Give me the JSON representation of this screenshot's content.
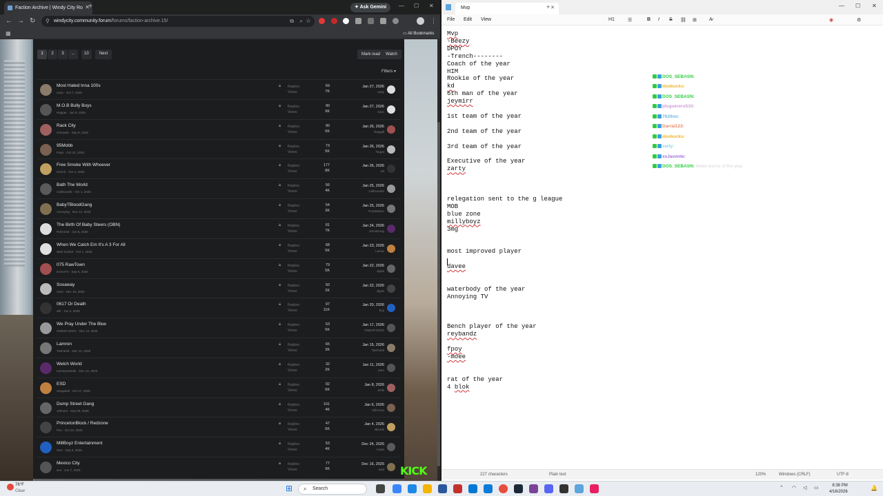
{
  "browser": {
    "tab_title": "Faction Archive | Windy City Ro",
    "ask_gemini": "Ask Gemini",
    "url_domain": "windycity.community.forum",
    "url_path": "/forums/faction-archive.15/",
    "all_bookmarks": "All Bookmarks"
  },
  "forum": {
    "pages": [
      "1",
      "2",
      "3",
      "...",
      "10",
      "Next"
    ],
    "mark_read": "Mark read",
    "watch": "Watch",
    "filters": "Filters ▾",
    "replies_label": "Replies:",
    "views_label": "Views:",
    "threads": [
      {
        "title": "Most Hated Inna 100s",
        "meta": "zarty · Oct 7, 2025",
        "replies": "69",
        "views": "7K",
        "date": "Jan 27, 2026",
        "user": "zarty"
      },
      {
        "title": "M.O.B Bully Boys",
        "meta": "Nappat · Jun 8, 2025",
        "replies": "90",
        "views": "9K",
        "date": "Jan 27, 2026",
        "user": "Dom"
      },
      {
        "title": "Rack City",
        "meta": "chrisweb · Sep 8, 2025",
        "replies": "90",
        "views": "5K",
        "date": "Jan 26, 2026",
        "user": "Rasgall"
      },
      {
        "title": "95Mobb",
        "meta": "Pops · Oct 22, 2025",
        "replies": "73",
        "views": "5K",
        "date": "Jan 26, 2026",
        "user": "Target"
      },
      {
        "title": "Free Smoke With Whoever",
        "meta": "Grinch · Oct 2, 2025",
        "replies": "177",
        "views": "8K",
        "date": "Jan 26, 2026",
        "user": "wit"
      },
      {
        "title": "Bath The World",
        "meta": "CallGooefe · Oct 1, 2025",
        "replies": "56",
        "views": "4K",
        "date": "Jan 25, 2026",
        "user": "CallGooefe"
      },
      {
        "title": "BabyTBloodGang",
        "meta": "Annoying · Nov 12, 2025",
        "replies": "54",
        "views": "3K",
        "date": "Jan 25, 2026",
        "user": "PurpMaxim"
      },
      {
        "title": "The Birth Of Baby Steers (OBN)",
        "meta": "RIZGrind · Jun 8, 2025",
        "replies": "81",
        "views": "7K",
        "date": "Jan 24, 2026",
        "user": "smooDoog"
      },
      {
        "title": "When We Catch Em It's A 3 For All",
        "meta": "Web Socket · Oct 1, 2025",
        "replies": "68",
        "views": "5K",
        "date": "Jan 23, 2026",
        "user": "Lamar"
      },
      {
        "title": "075 RawTown",
        "meta": "lcsmoTV · Sep 9, 2025",
        "replies": "79",
        "views": "5K",
        "date": "Jan 22, 2026",
        "user": "Jigsw"
      },
      {
        "title": "Sosaway",
        "meta": "Gars · Dec 19, 2025",
        "replies": "50",
        "views": "2K",
        "date": "Jan 22, 2026",
        "user": "Jigsw"
      },
      {
        "title": "0617 Or Death",
        "meta": "will · Jun 4, 2025",
        "replies": "97",
        "views": "11K",
        "date": "Jan 20, 2026",
        "user": "boy"
      },
      {
        "title": "We Pray Under The Blue",
        "meta": "ONEOF1DOG · Dec 14, 2025",
        "replies": "63",
        "views": "5K",
        "date": "Jan 17, 2026",
        "user": "ONEOF1DOG"
      },
      {
        "title": "Lamron",
        "meta": "TaxFamb · Dec 14, 2025",
        "replies": "65",
        "views": "3K",
        "date": "Jan 15, 2026",
        "user": "TaxFamb"
      },
      {
        "title": "Welch World",
        "meta": "moneymamde · Dec 14, 2025",
        "replies": "32",
        "views": "2K",
        "date": "Jan 11, 2026",
        "user": "pam"
      },
      {
        "title": "ESD",
        "meta": "sacapastl · Oct 17, 2025",
        "replies": "92",
        "views": "6K",
        "date": "Jan 8, 2026",
        "user": "Zelis"
      },
      {
        "title": "Dump Street Gang",
        "meta": "Jefmont · Sep 29, 2025",
        "replies": "101",
        "views": "4K",
        "date": "Jan 6, 2026",
        "user": "KillAmon"
      },
      {
        "title": "PrincetonBlock / Redzone",
        "meta": "Pex · Oct 23, 2025",
        "replies": "47",
        "views": "6K",
        "date": "Jan 4, 2026",
        "user": "Blends"
      },
      {
        "title": "MillBoyz Entertainment",
        "meta": "Gee · Sep 6, 2025",
        "replies": "53",
        "views": "4K",
        "date": "Dec 24, 2025",
        "user": "Kwits"
      },
      {
        "title": "Mexico City",
        "meta": "ses · Jun 7, 2025",
        "replies": "77",
        "views": "9K",
        "date": "Dec 16, 2025",
        "user": "said"
      }
    ]
  },
  "notepad": {
    "tab_title": "Mvp",
    "menu": [
      "File",
      "Edit",
      "View"
    ],
    "heading_btn": "H1",
    "lines": [
      {
        "t": "Mvp",
        "sq": true
      },
      {
        "t": "-Beezy",
        "sq": true
      },
      {
        "t": "DPOY"
      },
      {
        "t": "-Trench--------"
      },
      {
        "t": "Coach of the year"
      },
      {
        "t": "HIM"
      },
      {
        "t": "Rookie of the year"
      },
      {
        "t": "kd",
        "sq": true
      },
      {
        "t": "6th man of the year"
      },
      {
        "t": "jeymirr",
        "sq": true
      },
      {
        "t": ""
      },
      {
        "t": "1st team of the year"
      },
      {
        "t": ""
      },
      {
        "t": "2nd team of the year"
      },
      {
        "t": ""
      },
      {
        "t": "3rd team of the year"
      },
      {
        "t": ""
      },
      {
        "t": "Executive of the year"
      },
      {
        "t": "zarty",
        "sq": true
      },
      {
        "t": ""
      },
      {
        "t": ""
      },
      {
        "t": ""
      },
      {
        "t": "relegation sent to the g league"
      },
      {
        "t": "MOB"
      },
      {
        "t": "blue zone"
      },
      {
        "t": "millyboyz",
        "sq": true
      },
      {
        "t": "3mg"
      },
      {
        "t": ""
      },
      {
        "t": ""
      },
      {
        "t": "most improved player"
      },
      {
        "t": ""
      },
      {
        "t": "davee",
        "sq": true
      },
      {
        "t": ""
      },
      {
        "t": ""
      },
      {
        "t": "waterbody of the year"
      },
      {
        "t": "Annoying TV"
      },
      {
        "t": ""
      },
      {
        "t": ""
      },
      {
        "t": ""
      },
      {
        "t": "Bench player of the year"
      },
      {
        "t": "reybandz",
        "sq": true
      },
      {
        "t": ""
      },
      {
        "t": "fpoy",
        "sq": true
      },
      {
        "t": "-moee",
        "sq": true
      },
      {
        "t": ""
      },
      {
        "t": ""
      },
      {
        "t": "rat of the year"
      },
      {
        "t": "4 "
      },
      {
        "t": "blok",
        "sq": true
      }
    ],
    "status": {
      "chars": "227 characters",
      "format": "Plain text",
      "zoom": "120%",
      "eol": "Windows (CRLF)",
      "encoding": "UTF-8"
    }
  },
  "chat": [
    {
      "user": "DOS_SEBASN:",
      "msg": "",
      "color": "#2ecc40"
    },
    {
      "user": "doobucks:",
      "msg": "",
      "color": "#f0b429"
    },
    {
      "user": "DOS_SEBASN:",
      "msg": "",
      "color": "#2ecc40"
    },
    {
      "user": "jdsguerero510:",
      "msg": "",
      "color": "#d29bd8"
    },
    {
      "user": "762llno:",
      "msg": "",
      "color": "#6fb8e0"
    },
    {
      "user": "Darral123:",
      "msg": "",
      "color": "#e88a6a"
    },
    {
      "user": "doobucks:",
      "msg": "",
      "color": "#f0b429"
    },
    {
      "user": "zarty:",
      "msg": "",
      "color": "#8ad8e8"
    },
    {
      "user": "xxJavonte:",
      "msg": "",
      "color": "#a070e0"
    },
    {
      "user": "DOS_SEBASN:",
      "msg": "Make teams of the year",
      "color": "#2ecc40"
    }
  ],
  "kick_logo": "KICK",
  "taskbar": {
    "weather_temp": "76°F",
    "weather_desc": "Clear",
    "search": "Search",
    "time": "8:38 PM",
    "date": "4/16/2026"
  }
}
